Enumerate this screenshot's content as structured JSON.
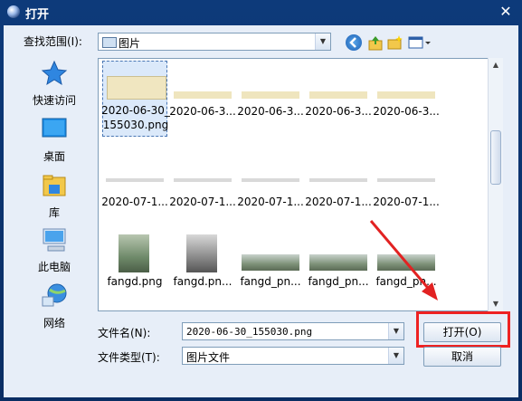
{
  "window": {
    "title": "打开",
    "close_glyph": "✕"
  },
  "lookin": {
    "label": "查找范围(I):",
    "value": "图片"
  },
  "toolbar_icons": [
    "back-icon",
    "up-folder-icon",
    "new-folder-icon",
    "view-menu-icon"
  ],
  "places": [
    {
      "label": "快速访问",
      "icon": "star-icon"
    },
    {
      "label": "桌面",
      "icon": "desktop-icon"
    },
    {
      "label": "库",
      "icon": "library-icon"
    },
    {
      "label": "此电脑",
      "icon": "computer-icon"
    },
    {
      "label": "网络",
      "icon": "network-icon"
    }
  ],
  "files": [
    {
      "name": "2020-06-30_",
      "name2": "155030.png",
      "kind": "doc",
      "selected": true
    },
    {
      "name": "2020-06-3...",
      "kind": "doc"
    },
    {
      "name": "2020-06-3...",
      "kind": "doc"
    },
    {
      "name": "2020-06-3...",
      "kind": "doc"
    },
    {
      "name": "2020-06-3...",
      "kind": "doc"
    },
    {
      "name": "2020-07-1...",
      "kind": "doc"
    },
    {
      "name": "2020-07-1...",
      "kind": "doc"
    },
    {
      "name": "2020-07-1...",
      "kind": "doc"
    },
    {
      "name": "2020-07-1...",
      "kind": "doc"
    },
    {
      "name": "2020-07-1...",
      "kind": "doc"
    },
    {
      "name": "fangd.png",
      "kind": "photo"
    },
    {
      "name": "fangd.pn...",
      "kind": "photo-bw"
    },
    {
      "name": "fangd_pn...",
      "kind": "landscape"
    },
    {
      "name": "fangd_pn...",
      "kind": "landscape"
    },
    {
      "name": "fangd_pn...",
      "kind": "landscape"
    }
  ],
  "filename": {
    "label": "文件名(N):",
    "value": "2020-06-30_155030.png"
  },
  "filetype": {
    "label": "文件类型(T):",
    "value": "图片文件"
  },
  "buttons": {
    "open": "打开(O)",
    "cancel": "取消"
  },
  "colors": {
    "highlight": "#e22222",
    "titlebar": "#0d3a7a"
  }
}
